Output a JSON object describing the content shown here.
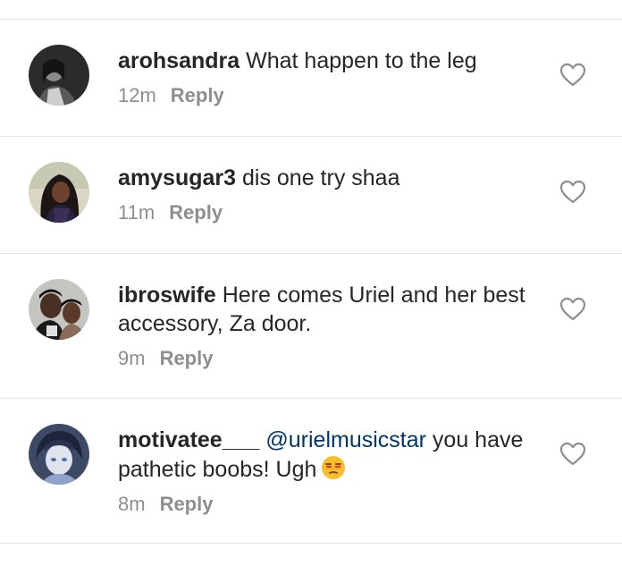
{
  "comments": [
    {
      "username": "arohsandra",
      "text": "What happen to the leg",
      "time": "12m",
      "reply_label": "Reply",
      "avatar": "avatar-woman-grayscale"
    },
    {
      "username": "amysugar3",
      "text": "dis one try shaa",
      "time": "11m",
      "reply_label": "Reply",
      "avatar": "avatar-woman-braids"
    },
    {
      "username": "ibroswife",
      "text": "Here comes Uriel and her best accessory, Za door.",
      "time": "9m",
      "reply_label": "Reply",
      "avatar": "avatar-couple"
    },
    {
      "username": "motivatee___",
      "mention": "@urielmusicstar",
      "text": "you have pathetic boobs! Ugh",
      "emoji": "unamused-face-emoji",
      "time": "8m",
      "reply_label": "Reply",
      "avatar": "avatar-anime-character"
    }
  ],
  "icons": {
    "like": "heart-outline-icon"
  },
  "colors": {
    "text": "#262626",
    "meta": "#8e8e8e",
    "mention": "#003569",
    "divider": "#e6e6e6"
  }
}
